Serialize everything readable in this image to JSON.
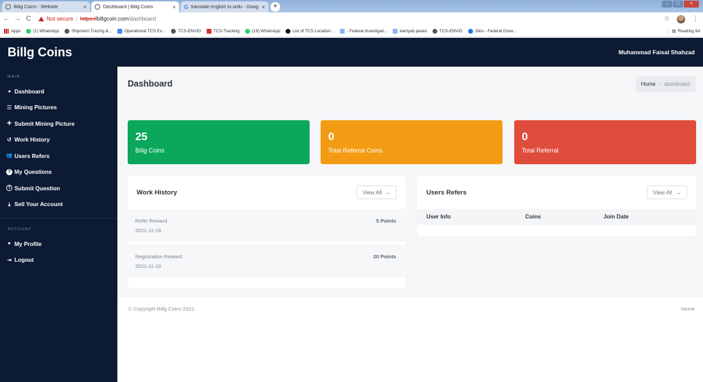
{
  "browser": {
    "tabs": [
      {
        "title": "Billg Coins - Website",
        "close": "×"
      },
      {
        "title": "Dashboard | Billg Coins",
        "close": "×"
      },
      {
        "title": "translate english to urdu - Goog",
        "close": "×"
      }
    ],
    "new_tab": "+",
    "window_controls": [
      "–",
      "□",
      "×"
    ],
    "nav": {
      "back": "←",
      "forward": "→",
      "reload": "C"
    },
    "security_label": "Not secure",
    "url_scheme": "https://",
    "url_host": "billgcoin.com",
    "url_path": "/dashboard",
    "bookmarks": [
      {
        "label": "Apps",
        "icon": "apps-icon"
      },
      {
        "label": "(1) WhatsApp",
        "icon": "whatsapp-icon"
      },
      {
        "label": "Shipment Tracing &...",
        "icon": "globe-icon"
      },
      {
        "label": "Operational TCS Ex...",
        "icon": "doc-icon"
      },
      {
        "label": "TCS-ENVIO",
        "icon": "globe-icon"
      },
      {
        "label": "TCS-Tracking",
        "icon": "tag-icon"
      },
      {
        "label": "(19) WhatsApp",
        "icon": "whatsapp-icon"
      },
      {
        "label": "List of TCS Location...",
        "icon": "phone-icon"
      },
      {
        "label": "- Federal Investigati...",
        "icon": "image-icon"
      },
      {
        "label": "kamyab jawan",
        "icon": "image-icon"
      },
      {
        "label": "TCS-ENVIO",
        "icon": "globe-icon"
      },
      {
        "label": "Jobs - Federal Gove...",
        "icon": "circle-icon"
      }
    ],
    "reading_list": "Reading list"
  },
  "brand": "Billg Coins",
  "user_name": "Muhammad Faisal Shahzad",
  "sidebar": {
    "main_section": "MAIN",
    "main_items": [
      {
        "label": "Dashboard",
        "icon": "dashboard-icon",
        "glyph": "◕"
      },
      {
        "label": "Mining Pictures",
        "icon": "list-icon",
        "glyph": "☰"
      },
      {
        "label": "Submit Mining Picture",
        "icon": "plus-icon",
        "glyph": "+"
      },
      {
        "label": "Work History",
        "icon": "history-icon",
        "glyph": "↺"
      },
      {
        "label": "Users Refers",
        "icon": "users-icon",
        "glyph": "👥"
      },
      {
        "label": "My Questions",
        "icon": "question-icon",
        "glyph": "?"
      },
      {
        "label": "Submit Question",
        "icon": "question-circle-icon",
        "glyph": "?"
      },
      {
        "label": "Sell Your Account",
        "icon": "user-sell-icon",
        "glyph": "⤓"
      }
    ],
    "account_section": "ACCOUNT",
    "account_items": [
      {
        "label": "My Profile",
        "icon": "user-icon",
        "glyph": "●"
      },
      {
        "label": "Logout",
        "icon": "logout-icon",
        "glyph": "⇥"
      }
    ]
  },
  "page": {
    "title": "Dashboard",
    "breadcrumb": {
      "home": "Home",
      "separator": "›",
      "current": "dashboard"
    }
  },
  "stats": [
    {
      "value": "25",
      "label": "Billg Coins",
      "color": "#0ba85c"
    },
    {
      "value": "0",
      "label": "Total Referral Coins",
      "color": "#f39c13"
    },
    {
      "value": "0",
      "label": "Total Referral",
      "color": "#e04c3b"
    }
  ],
  "work_history": {
    "title": "Work History",
    "view_all": "View All",
    "view_all_arrow": "→",
    "rows": [
      {
        "name": "Refer Reward",
        "date": "2021-11-16",
        "points": "5 Points"
      },
      {
        "name": "Registration Reward",
        "date": "2021-11-16",
        "points": "20 Points"
      }
    ]
  },
  "users_refers": {
    "title": "Users Refers",
    "view_all": "View All",
    "view_all_arrow": "→",
    "columns": [
      "User Info",
      "Coins",
      "Join Date"
    ]
  },
  "footer": {
    "copyright": "© Copyright Billg Coins 2021.",
    "home_link": "Home"
  }
}
